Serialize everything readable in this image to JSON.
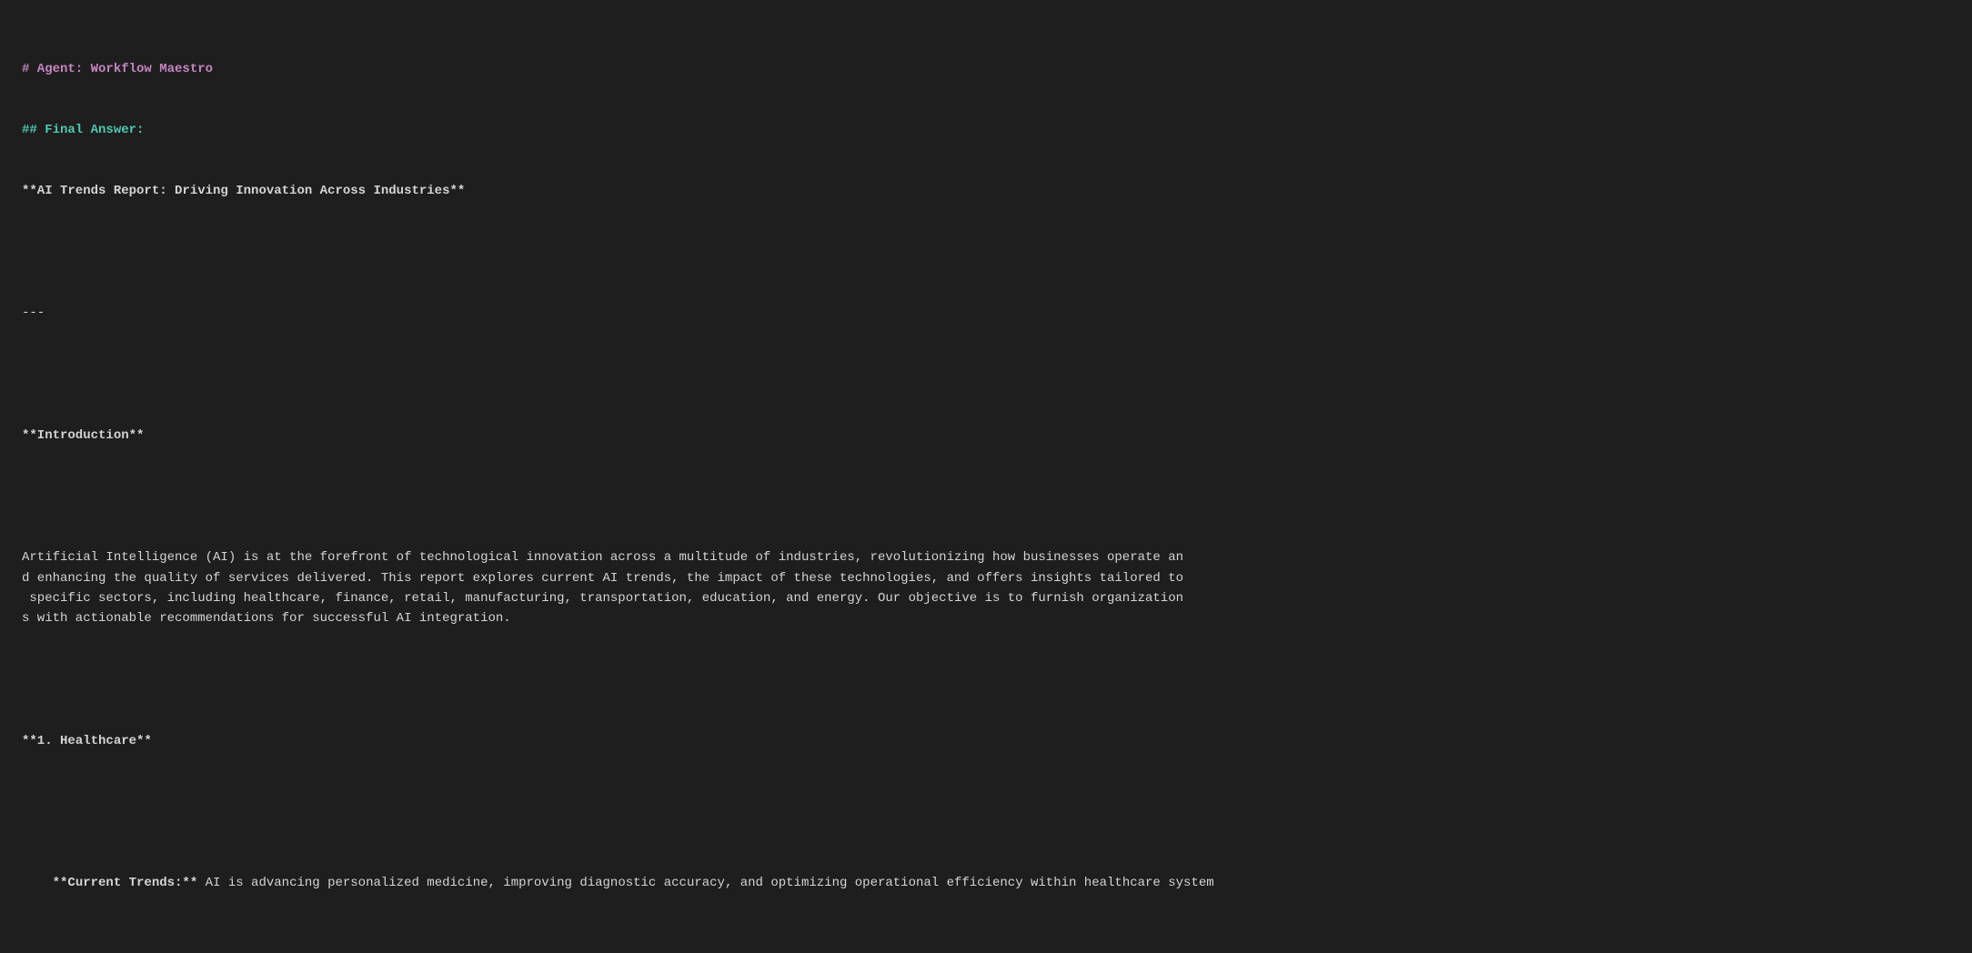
{
  "content": {
    "agent_line": "# Agent: Workflow Maestro",
    "final_answer_heading": "## Final Answer:",
    "report_title": "**AI Trends Report: Driving Innovation Across Industries**",
    "separator": "---",
    "intro_heading": "**Introduction**",
    "intro_para": "Artificial Intelligence (AI) is at the forefront of technological innovation across a multitude of industries, revolutionizing how businesses operate an\nd enhancing the quality of services delivered. This report explores current AI trends, the impact of these technologies, and offers insights tailored to\n specific sectors, including healthcare, finance, retail, manufacturing, transportation, education, and energy. Our objective is to furnish organization\ns with actionable recommendations for successful AI integration.",
    "section1_heading": "**1. Healthcare**",
    "section1_trends_label": "**Current Trends:**",
    "section1_trends_text": " AI is advancing personalized medicine, improving diagnostic accuracy, and optimizing operational efficiency within healthcare system"
  },
  "colors": {
    "agent_color": "#c586c0",
    "heading2_color": "#4ec9b0",
    "normal_color": "#d4d4d4",
    "background": "#1e1e1e"
  }
}
